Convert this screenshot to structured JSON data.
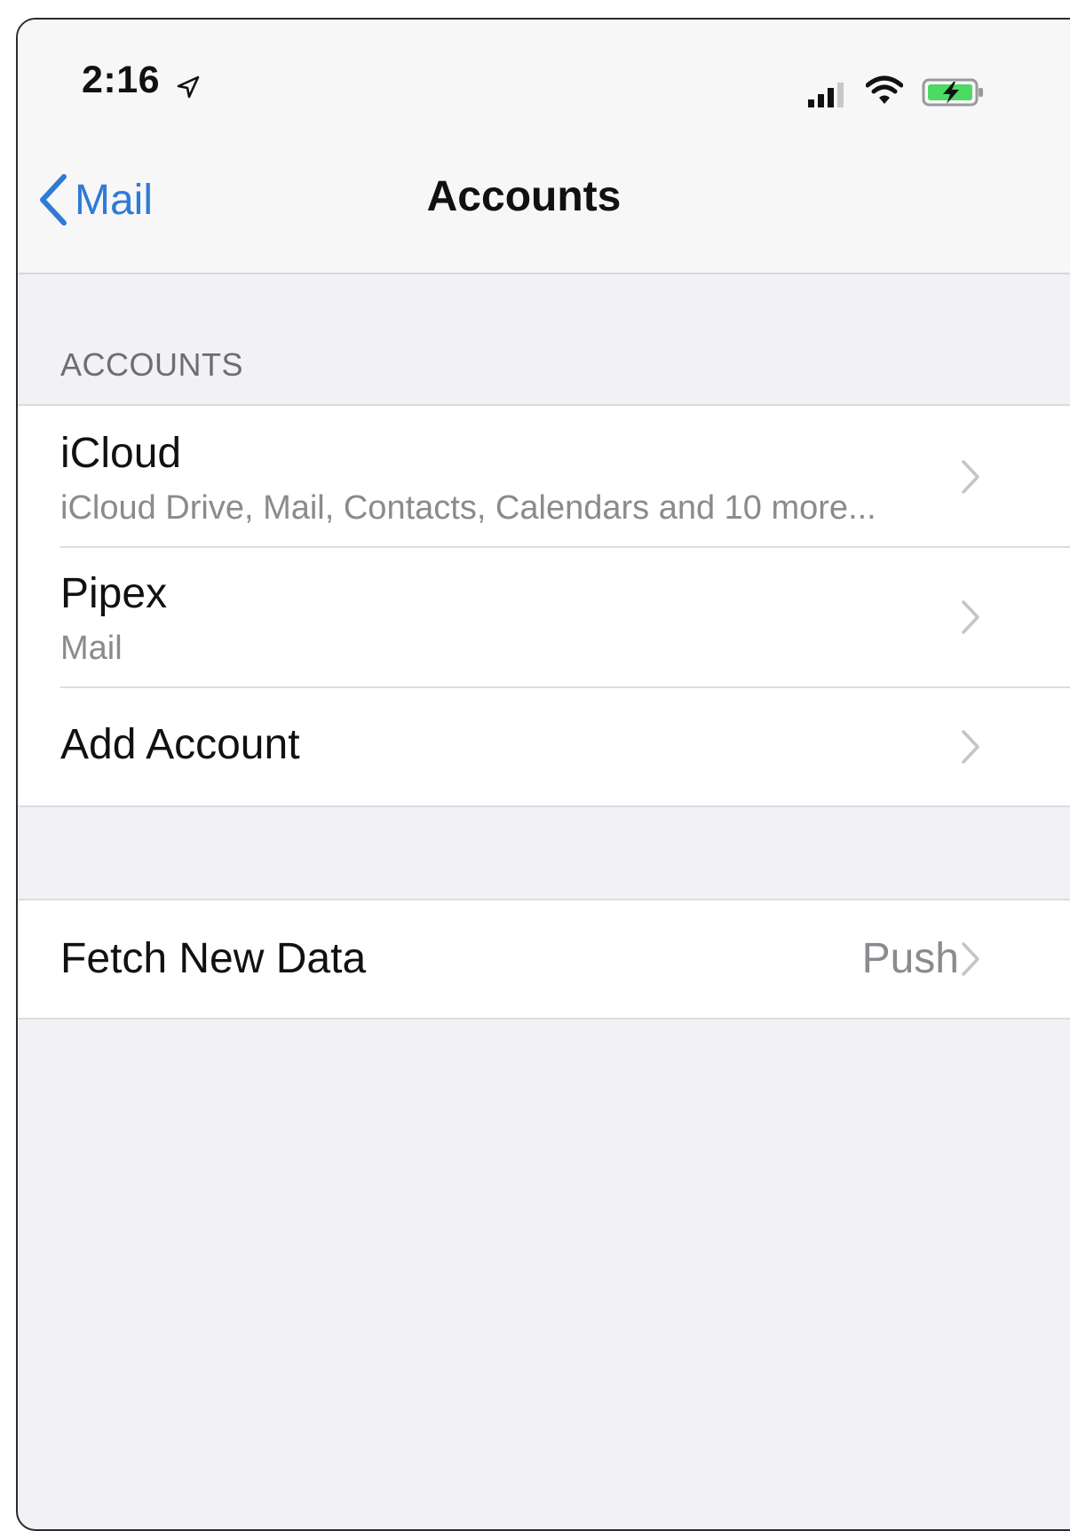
{
  "status_bar": {
    "time": "2:16",
    "icons": [
      "location-arrow-icon",
      "cellular-signal-icon",
      "wifi-icon",
      "battery-charging-icon"
    ]
  },
  "nav": {
    "back_label": "Mail",
    "title": "Accounts"
  },
  "accounts_section": {
    "header": "ACCOUNTS",
    "items": [
      {
        "title": "iCloud",
        "subtitle": "iCloud Drive, Mail, Contacts, Calendars and 10 more..."
      },
      {
        "title": "Pipex",
        "subtitle": "Mail"
      },
      {
        "title": "Add Account"
      }
    ]
  },
  "fetch_section": {
    "title": "Fetch New Data",
    "value": "Push"
  },
  "colors": {
    "accent": "#2f7bd6",
    "background": "#f2f2f6",
    "battery": "#4cd964"
  }
}
